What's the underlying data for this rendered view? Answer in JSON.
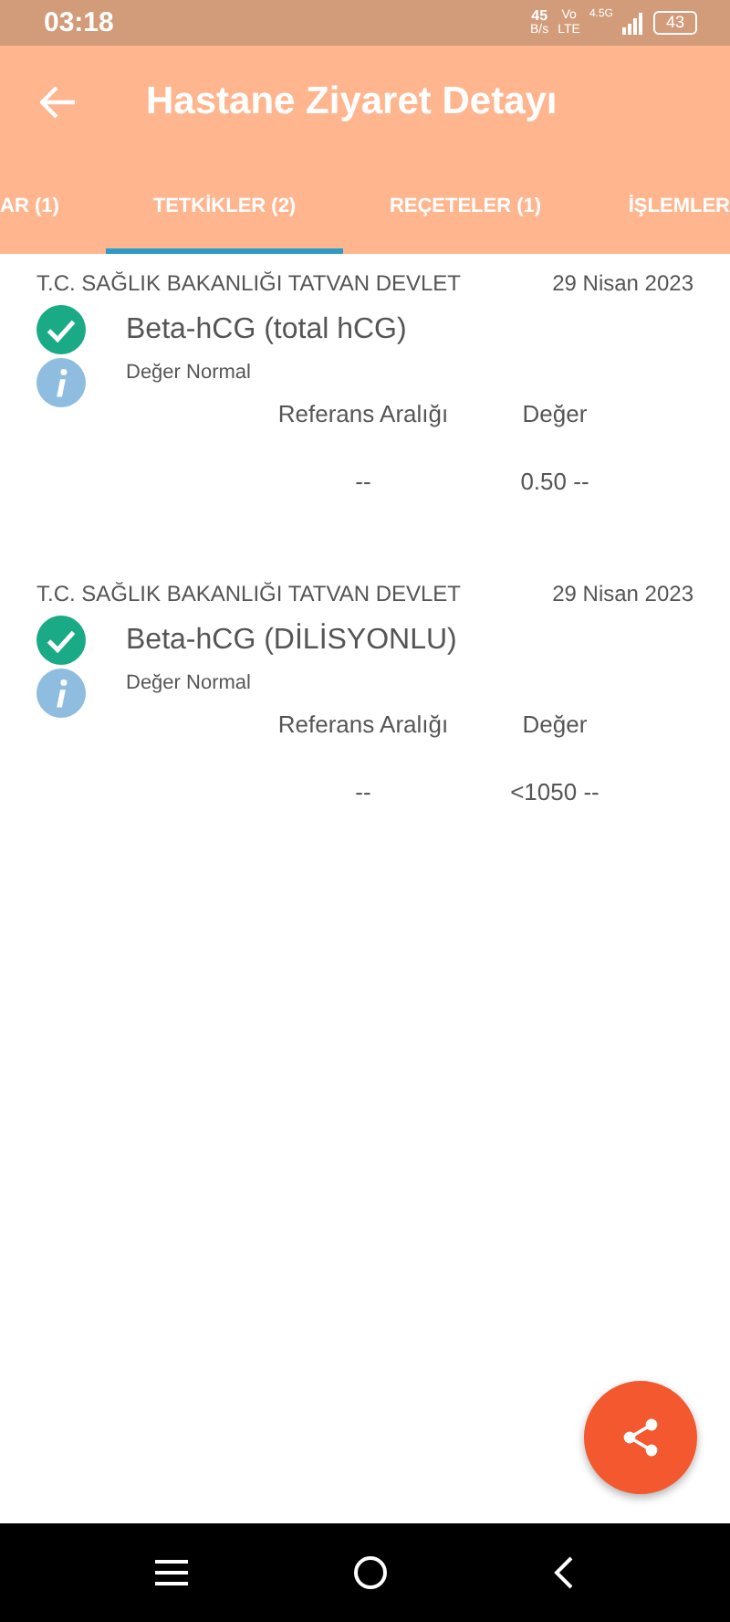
{
  "status_bar": {
    "time": "03:18",
    "speed": "45",
    "speed_unit": "B/s",
    "volte": "Vo",
    "volte_sub": "LTE",
    "network": "4.5G",
    "battery": "43"
  },
  "app_bar": {
    "title": "Hastane Ziyaret Detayı"
  },
  "tabs": [
    {
      "label": "AR (1)",
      "selected": false
    },
    {
      "label": "TETKİKLER (2)",
      "selected": true
    },
    {
      "label": "REÇETELER (1)",
      "selected": false
    },
    {
      "label": "İŞLEMLER",
      "selected": false
    }
  ],
  "results": [
    {
      "hospital": "T.C. SAĞLIK BAKANLIĞI TATVAN DEVLET",
      "date": "29 Nisan 2023",
      "test": "Beta-hCG (total hCG)",
      "status": "Değer Normal",
      "range_header": "Referans Aralığı",
      "value_header": "Değer",
      "range": "--",
      "value": "0.50 --"
    },
    {
      "hospital": "T.C. SAĞLIK BAKANLIĞI TATVAN DEVLET",
      "date": "29 Nisan 2023",
      "test": "Beta-hCG (DİLİSYONLU)",
      "status": "Değer Normal",
      "range_header": "Referans Aralığı",
      "value_header": "Değer",
      "range": "--",
      "value": "<1050 --"
    }
  ]
}
